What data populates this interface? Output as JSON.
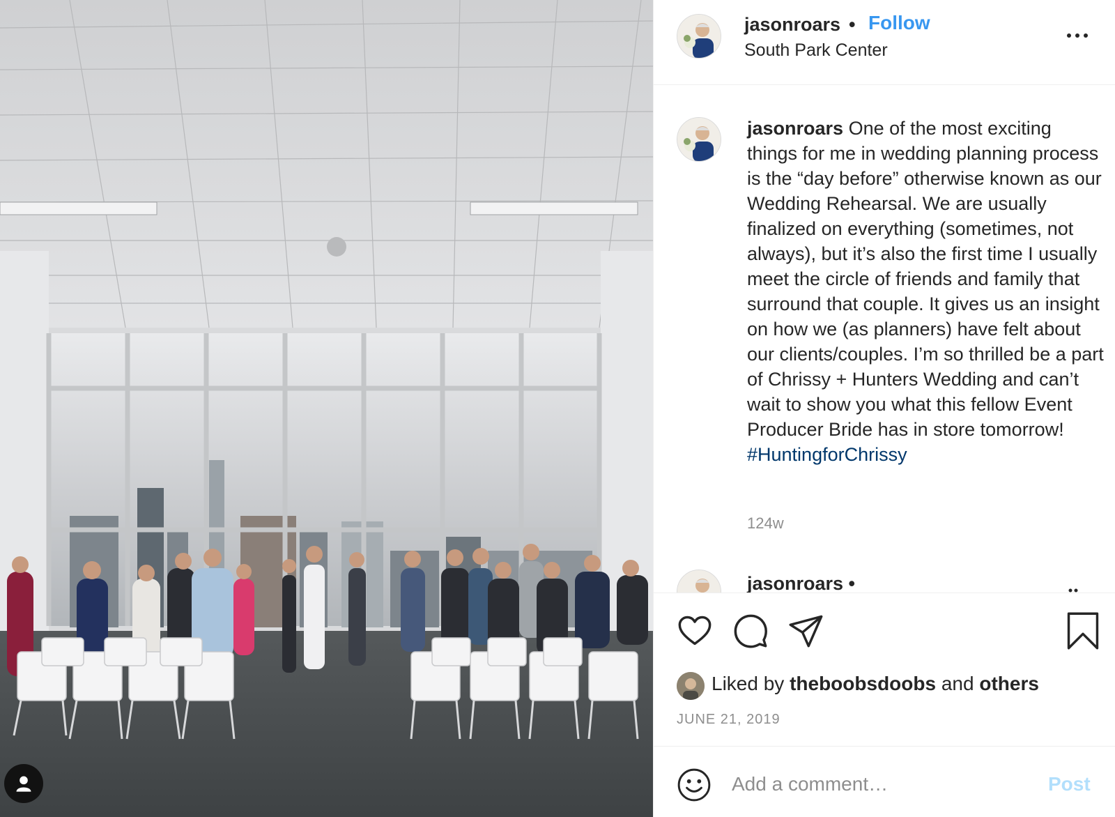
{
  "post": {
    "username": "jasonroars",
    "separator": "•",
    "follow_label": "Follow",
    "location": "South Park Center",
    "caption_text": "One of the most exciting things for me in wedding planning process is the “day before” otherwise known as our Wedding Rehearsal. We are usually finalized on everything (sometimes, not always), but it’s also the first time I usually meet the circle of friends and family that surround that couple. It gives us an insight on how we (as planners) have felt about our clients/couples. I’m so thrilled be a part of Chrissy + Hunters Wedding and can’t wait to show you what this fellow Event Producer Bride has in store tomorrow!",
    "hashtag": "#HuntingforChrissy",
    "time_ago": "124w",
    "reply_username": "jasonroars •"
  },
  "likes": {
    "prefix": "Liked by",
    "user": "theboobsdoobs",
    "middle": "and",
    "others": "others"
  },
  "date": "JUNE 21, 2019",
  "comment": {
    "placeholder": "Add a comment…",
    "post_label": "Post"
  },
  "colors": {
    "link_blue": "#3897f0",
    "hashtag": "#00376b",
    "post_disabled": "#b2dffc",
    "secondary_text": "#8e8e8e"
  },
  "icons": {
    "tag": "user-tag-icon",
    "more": "more-options-icon",
    "like": "heart-icon",
    "comment": "comment-icon",
    "share": "paper-plane-icon",
    "save": "bookmark-icon",
    "emoji": "smiley-icon"
  }
}
